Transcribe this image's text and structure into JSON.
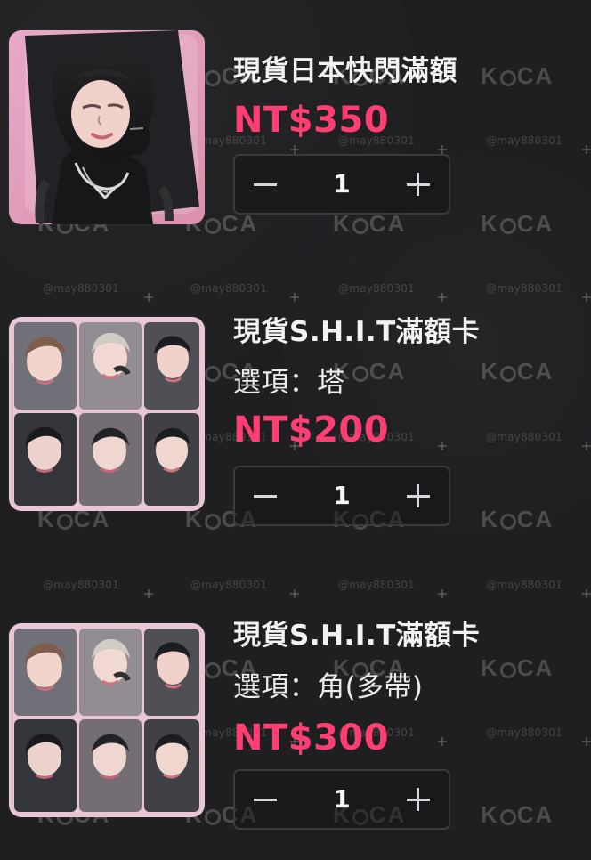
{
  "items": [
    {
      "title": "現貨日本快閃滿額",
      "price": "NT$350",
      "quantity": "1",
      "image_name": "photocard-image"
    },
    {
      "title": "現貨S.H.I.T滿額卡",
      "option": "選項：塔",
      "price": "NT$200",
      "quantity": "1",
      "image_name": "photocard-set-image"
    },
    {
      "title": "現貨S.H.I.T滿額卡",
      "option": "選項：角(多帶)",
      "price": "NT$300",
      "quantity": "1",
      "image_name": "photocard-set-image"
    }
  ],
  "watermarks": {
    "handle": "@may880301",
    "logo": "KOCA"
  }
}
